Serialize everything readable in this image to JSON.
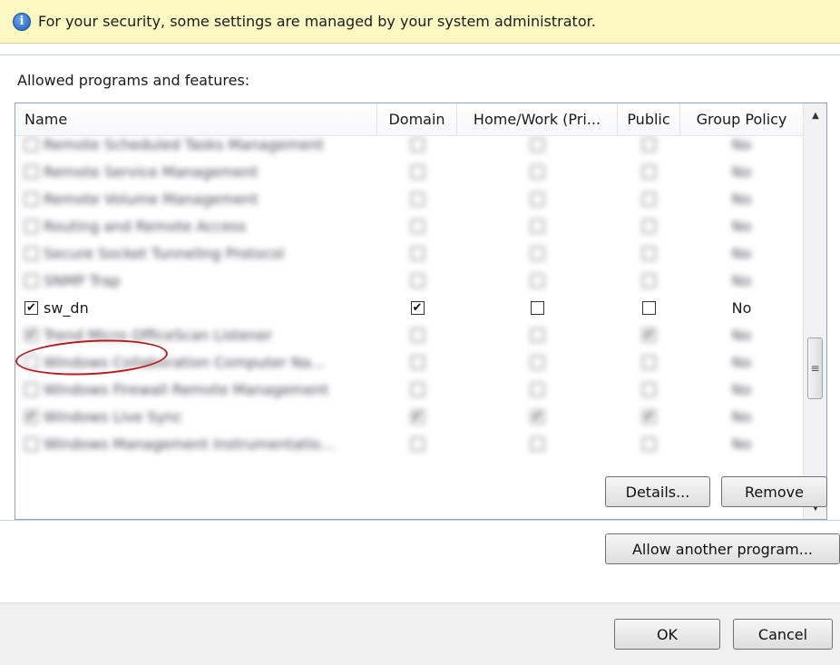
{
  "infobar": {
    "icon": "info-icon",
    "text": "For your security, some settings are managed by your system administrator."
  },
  "list": {
    "label": "Allowed programs and features:",
    "columns": [
      "Name",
      "Domain",
      "Home/Work (Pri...",
      "Public",
      "Group Policy"
    ],
    "rows": [
      {
        "name": "Remote Scheduled Tasks Management",
        "checked": false,
        "domain": false,
        "home": false,
        "public": false,
        "gp": "No",
        "blurred": true
      },
      {
        "name": "Remote Service Management",
        "checked": false,
        "domain": false,
        "home": false,
        "public": false,
        "gp": "No",
        "blurred": true
      },
      {
        "name": "Remote Volume Management",
        "checked": false,
        "domain": false,
        "home": false,
        "public": false,
        "gp": "No",
        "blurred": true
      },
      {
        "name": "Routing and Remote Access",
        "checked": false,
        "domain": false,
        "home": false,
        "public": false,
        "gp": "No",
        "blurred": true
      },
      {
        "name": "Secure Socket Tunneling Protocol",
        "checked": false,
        "domain": false,
        "home": false,
        "public": false,
        "gp": "No",
        "blurred": true
      },
      {
        "name": "SNMP Trap",
        "checked": false,
        "domain": false,
        "home": false,
        "public": false,
        "gp": "No",
        "blurred": true
      },
      {
        "name": "sw_dn",
        "checked": true,
        "domain": true,
        "home": false,
        "public": false,
        "gp": "No",
        "blurred": false
      },
      {
        "name": "Trend Micro OfficeScan Listener",
        "checked": true,
        "domain": false,
        "home": false,
        "public": true,
        "gp": "No",
        "blurred": true
      },
      {
        "name": "Windows Collaboration Computer Na...",
        "checked": false,
        "domain": false,
        "home": false,
        "public": false,
        "gp": "No",
        "blurred": true
      },
      {
        "name": "Windows Firewall Remote Management",
        "checked": false,
        "domain": false,
        "home": false,
        "public": false,
        "gp": "No",
        "blurred": true
      },
      {
        "name": "Windows Live Sync",
        "checked": true,
        "domain": true,
        "home": true,
        "public": true,
        "gp": "No",
        "blurred": true
      },
      {
        "name": "Windows Management Instrumentatio...",
        "checked": false,
        "domain": false,
        "home": false,
        "public": false,
        "gp": "No",
        "blurred": true
      }
    ]
  },
  "buttons": {
    "details": "Details...",
    "remove": "Remove",
    "allow_another": "Allow another program...",
    "ok": "OK",
    "cancel": "Cancel"
  },
  "icons": {
    "scroll_up": "scroll-up-arrow-icon",
    "scroll_down": "scroll-down-arrow-icon",
    "checkmark": "checkmark-icon"
  }
}
